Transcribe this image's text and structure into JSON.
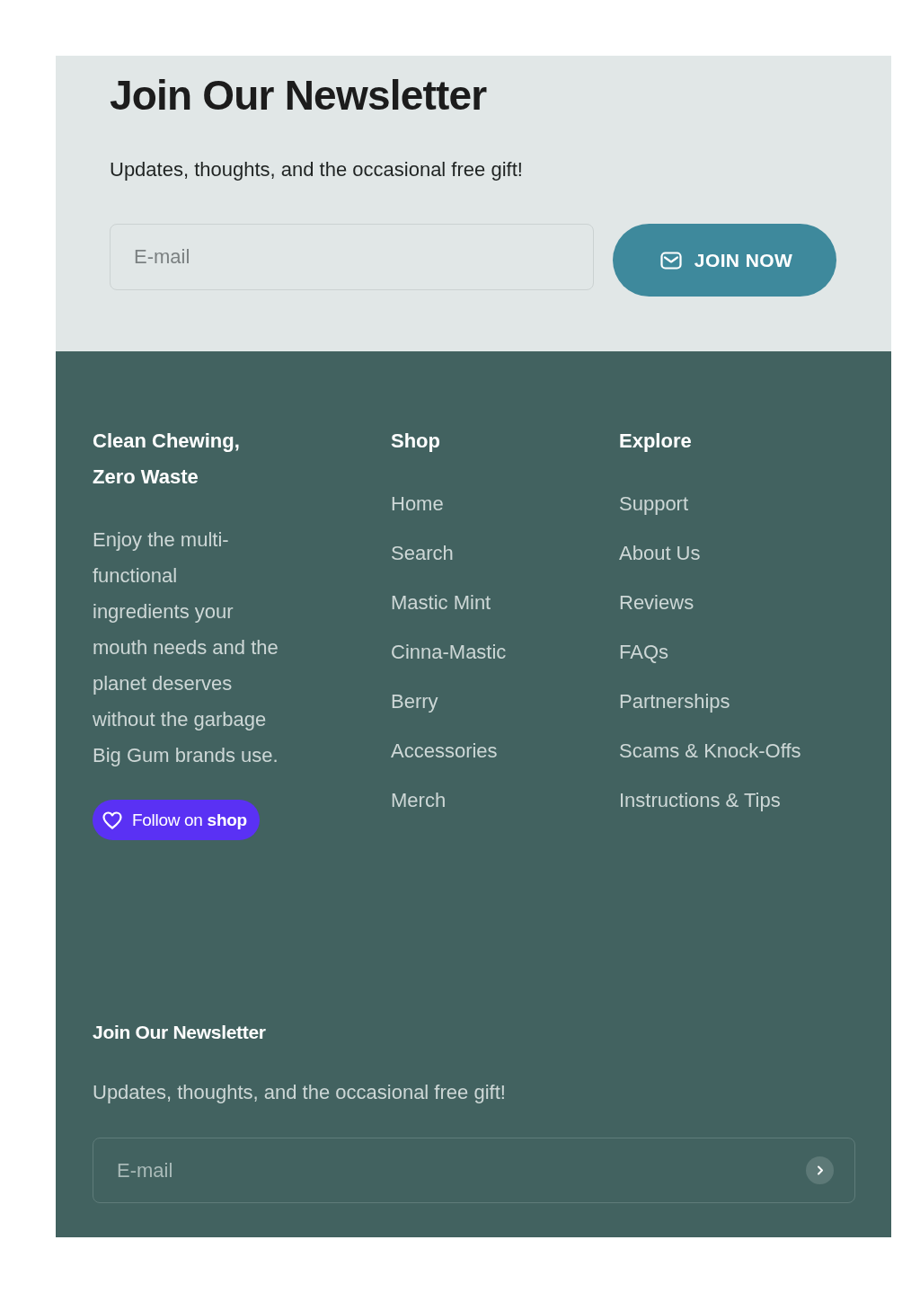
{
  "newsletter": {
    "title": "Join Our Newsletter",
    "subtitle": "Updates, thoughts, and the occasional free gift!",
    "email": {
      "placeholder": "E-mail"
    },
    "button": "JOIN NOW"
  },
  "footer": {
    "brand": {
      "title": "Clean Chewing, Zero Waste",
      "text": "Enjoy the multi-functional ingredients your mouth needs and the planet deserves without the garbage Big Gum brands use.",
      "follow_button": "Follow on **shop**"
    },
    "menus": [
      {
        "title": "Shop",
        "links": [
          "Home",
          "Search",
          "Mastic Mint",
          "Cinna-Mastic",
          "Berry",
          "Accessories",
          "Merch"
        ]
      },
      {
        "title": "Explore",
        "links": [
          "Support",
          "About Us",
          "Reviews",
          "FAQs",
          "Partnerships",
          "Scams & Knock-Offs",
          "Instructions & Tips"
        ]
      }
    ],
    "signup": {
      "title": "Join Our Newsletter",
      "subtitle": "Updates, thoughts, and the occasional free gift!",
      "email": {
        "placeholder": "E-mail"
      }
    }
  }
}
